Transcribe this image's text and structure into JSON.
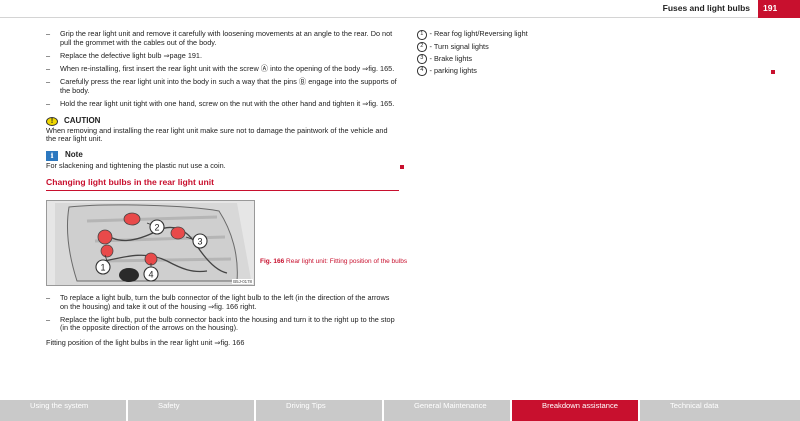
{
  "header": {
    "title": "Fuses and light bulbs",
    "page_number": "191"
  },
  "steps_top": [
    "Grip the rear light unit and remove it carefully with loosening movements at an angle to the rear. Do not pull the grommet with the cables out of the body.",
    "Replace the defective light bulb ⇒page 191.",
    "When re-installing, first insert the rear light unit with the screw Ⓐ into the opening of the body ⇒fig. 165.",
    "Carefully press the rear light unit into the body in such a way that the pins Ⓑ engage into the supports of the body.",
    "Hold the rear light unit tight with one hand, screw on the nut with the other hand and tighten it ⇒fig. 165."
  ],
  "caution": {
    "heading": "CAUTION",
    "icon_glyph": "!",
    "text": "When removing and installing the rear light unit make sure not to damage the paintwork of the vehicle and the rear light unit."
  },
  "note": {
    "heading": "Note",
    "icon_glyph": "i",
    "text": "For slackening and tightening the plastic nut use a coin."
  },
  "section": {
    "title": "Changing light bulbs in the rear light unit"
  },
  "figure": {
    "code": "B5J-0178",
    "caption_label": "Fig. 166",
    "caption_text": "Rear light unit: Fitting position of the bulbs",
    "callouts": [
      "1",
      "2",
      "3",
      "4"
    ]
  },
  "steps_bottom": [
    "To replace a light bulb, turn the bulb connector of the light bulb to the left (in the direction of the arrows on the housing) and take it out of the housing ⇒fig. 166 right.",
    "Replace the light bulb, put the bulb connector back into the housing and turn it to the right up to the stop (in the opposite direction of the arrows on the housing)."
  ],
  "closing_text": "Fitting position of the light bulbs in the rear light unit ⇒fig. 166",
  "legend": [
    {
      "num": "1",
      "label": "- Rear fog light/Reversing light"
    },
    {
      "num": "2",
      "label": "- Turn signal lights"
    },
    {
      "num": "3",
      "label": "- Brake lights"
    },
    {
      "num": "4",
      "label": "- parking lights"
    }
  ],
  "footer_tabs": [
    {
      "label": "Using the system",
      "active": false
    },
    {
      "label": "Safety",
      "active": false
    },
    {
      "label": "Driving Tips",
      "active": false
    },
    {
      "label": "General Maintenance",
      "active": false
    },
    {
      "label": "Breakdown assistance",
      "active": true
    },
    {
      "label": "Technical data",
      "active": false
    }
  ],
  "colors": {
    "accent": "#c8102e",
    "tab_inactive": "#c9c9c9",
    "caution_yellow": "#f0d800",
    "note_blue": "#2c78c0"
  },
  "dash_glyph": "–"
}
